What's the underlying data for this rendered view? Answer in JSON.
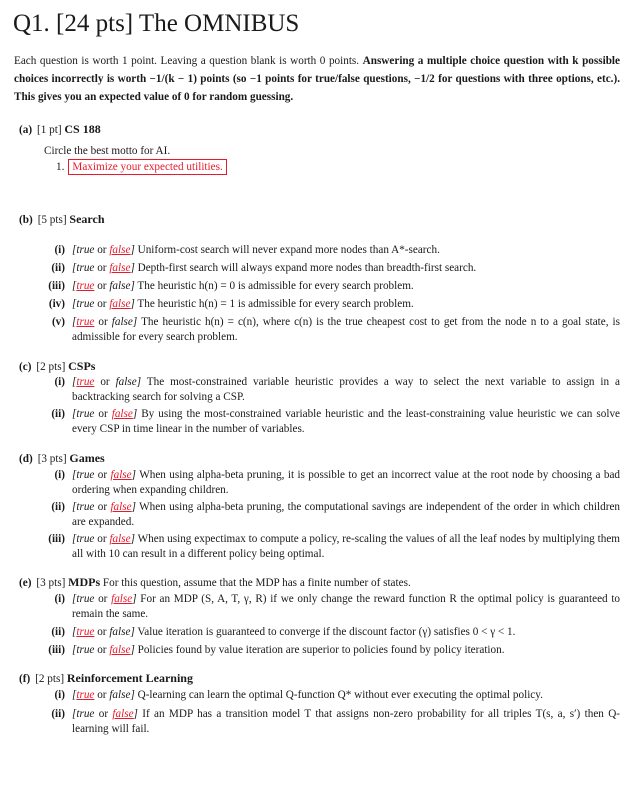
{
  "title": "Q1. [24 pts] The OMNIBUS",
  "intro": {
    "normal": "Each question is worth 1 point. Leaving a question blank is worth 0 points.",
    "bold": "Answering a multiple choice question with k possible choices incorrectly is worth −1/(k − 1) points (so −1 points for true/false questions, −1/2 for questions with three options, etc.). This gives you an expected value of 0 for random guessing."
  },
  "accent_color": "#e8192c",
  "part_a": {
    "label": "(a)",
    "pts": "[1 pt]",
    "name": "CS 188",
    "description": "Circle the best motto for AI.",
    "choice_num": "1.",
    "choice_text": "Maximize your expected utilities."
  },
  "parts": [
    {
      "label": "(b)",
      "pts": "[5 pts]",
      "name": "Search",
      "description": "",
      "items": [
        {
          "num": "(i)",
          "answer": "false",
          "text": "Uniform-cost search will never expand more nodes than A*-search."
        },
        {
          "num": "(ii)",
          "answer": "false",
          "text": "Depth-first search will always expand more nodes than breadth-first search."
        },
        {
          "num": "(iii)",
          "answer": "true",
          "text": "The heuristic h(n) = 0 is admissible for every search problem."
        },
        {
          "num": "(iv)",
          "answer": "false",
          "text": "The heuristic h(n) = 1 is admissible for every search problem."
        },
        {
          "num": "(v)",
          "answer": "true",
          "text": "The heuristic h(n) = c(n), where c(n) is the true cheapest cost to get from the node n to a goal state, is admissible for every search problem."
        }
      ]
    },
    {
      "label": "(c)",
      "pts": "[2 pts]",
      "name": "CSPs",
      "description": "",
      "items": [
        {
          "num": "(i)",
          "answer": "true",
          "text": "The most-constrained variable heuristic provides a way to select the next variable to assign in a backtracking search for solving a CSP."
        },
        {
          "num": "(ii)",
          "answer": "false",
          "text": "By using the most-constrained variable heuristic and the least-constraining value heuristic we can solve every CSP in time linear in the number of variables."
        }
      ]
    },
    {
      "label": "(d)",
      "pts": "[3 pts]",
      "name": "Games",
      "description": "",
      "items": [
        {
          "num": "(i)",
          "answer": "false",
          "text": "When using alpha-beta pruning, it is possible to get an incorrect value at the root node by choosing a bad ordering when expanding children."
        },
        {
          "num": "(ii)",
          "answer": "false",
          "text": "When using alpha-beta pruning, the computational savings are independent of the order in which children are expanded."
        },
        {
          "num": "(iii)",
          "answer": "false",
          "text": "When using expectimax to compute a policy, re-scaling the values of all the leaf nodes by multiplying them all with 10 can result in a different policy being optimal."
        }
      ]
    },
    {
      "label": "(e)",
      "pts": "[3 pts]",
      "name": "MDPs",
      "description": "For this question, assume that the MDP has a finite number of states.",
      "items": [
        {
          "num": "(i)",
          "answer": "false",
          "text": "For an MDP (S, A, T, γ, R) if we only change the reward function R the optimal policy is guaranteed to remain the same."
        },
        {
          "num": "(ii)",
          "answer": "true",
          "text": "Value iteration is guaranteed to converge if the discount factor (γ) satisfies 0 < γ < 1."
        },
        {
          "num": "(iii)",
          "answer": "false",
          "text": "Policies found by value iteration are superior to policies found by policy iteration."
        }
      ]
    },
    {
      "label": "(f)",
      "pts": "[2 pts]",
      "name": "Reinforcement Learning",
      "description": "",
      "items": [
        {
          "num": "(i)",
          "answer": "true",
          "text": "Q-learning can learn the optimal Q-function Q* without ever executing the optimal policy."
        },
        {
          "num": "(ii)",
          "answer": "false",
          "text": "If an MDP has a transition model T that assigns non-zero probability for all triples T(s, a, s′) then Q-learning will fail."
        }
      ]
    }
  ],
  "labels": {
    "true": "true",
    "or": "or",
    "false": "false"
  }
}
